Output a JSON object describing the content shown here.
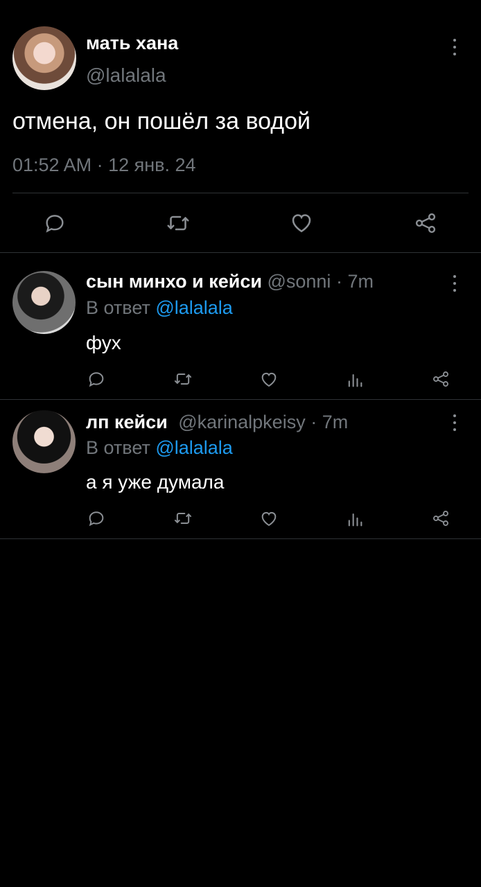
{
  "main_tweet": {
    "display_name": "мать хана",
    "handle": "@lalalala",
    "text": "отмена, он пошёл за водой",
    "timestamp": "01:52 AM · 12 янв. 24",
    "actions": [
      "reply-icon",
      "retweet-icon",
      "like-icon",
      "share-icon"
    ]
  },
  "replies": [
    {
      "display_name": "сын минхо и кейси",
      "handle": "@sonni",
      "time": "· 7m",
      "reply_prefix": "В ответ",
      "reply_to": "@lalalala",
      "text": "фух"
    },
    {
      "display_name": "лп кейси",
      "handle": "@karinalpkeisy",
      "time": "· 7m",
      "reply_prefix": "В ответ",
      "reply_to": "@lalalala",
      "text": "а я уже думала"
    }
  ],
  "colors": {
    "background": "#000000",
    "text": "#e7e9ea",
    "muted": "#71767b",
    "link": "#1d9bf0",
    "divider": "#2f3336"
  }
}
